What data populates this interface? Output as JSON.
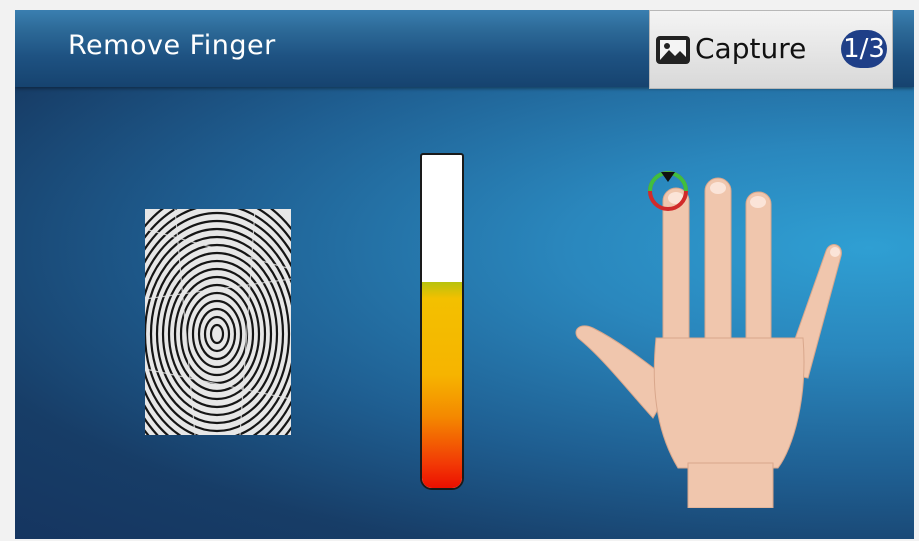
{
  "header": {
    "title": "Remove Finger",
    "capture_label": "Capture",
    "capture_counter": "1/3"
  },
  "icons": {
    "capture": "image-icon",
    "finger_marker": "finger-target-icon"
  },
  "quality_meter": {
    "level_fraction": 0.62
  },
  "colors": {
    "header_bar": "#1e5282",
    "badge": "#1f3f88",
    "meter_low": "#ec0f00",
    "meter_mid": "#f6b400",
    "marker_ring": "#d12a2a",
    "marker_active": "#3fbf3f"
  }
}
